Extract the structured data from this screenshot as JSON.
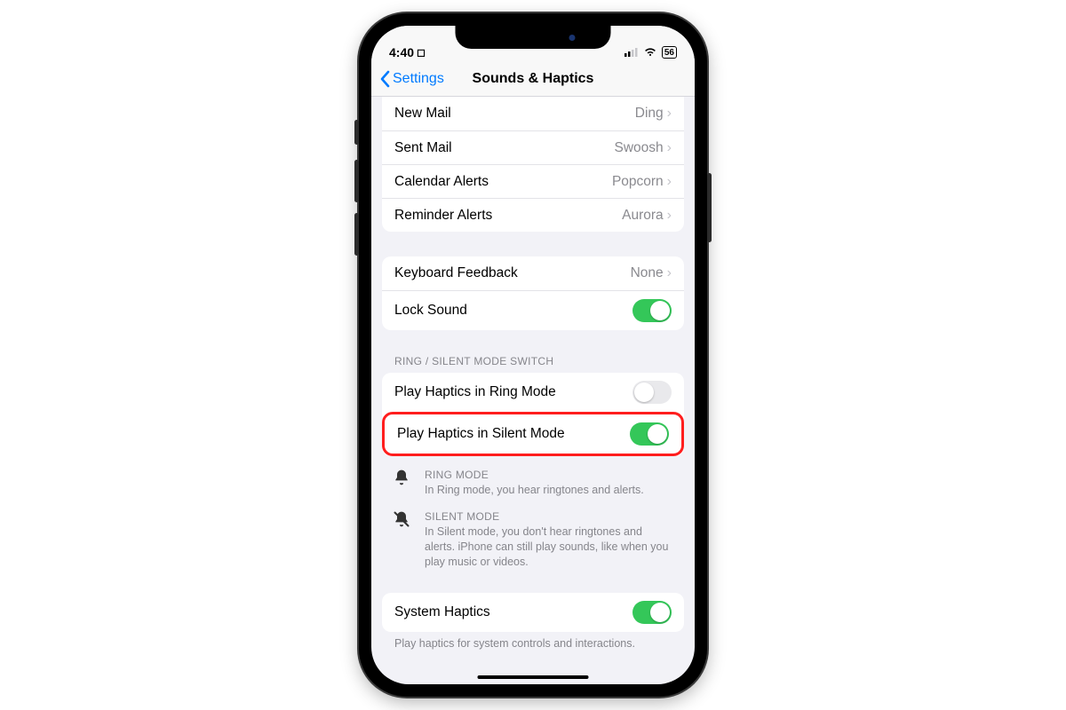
{
  "status": {
    "time": "4:40",
    "battery": "56"
  },
  "nav": {
    "back": "Settings",
    "title": "Sounds & Haptics"
  },
  "sounds": {
    "new_mail": {
      "label": "New Mail",
      "value": "Ding"
    },
    "sent_mail": {
      "label": "Sent Mail",
      "value": "Swoosh"
    },
    "calendar": {
      "label": "Calendar Alerts",
      "value": "Popcorn"
    },
    "reminder": {
      "label": "Reminder Alerts",
      "value": "Aurora"
    }
  },
  "feedback": {
    "keyboard": {
      "label": "Keyboard Feedback",
      "value": "None"
    },
    "lock": {
      "label": "Lock Sound"
    }
  },
  "section_ring_header": "RING / SILENT MODE SWITCH",
  "haptics": {
    "ring": {
      "label": "Play Haptics in Ring Mode"
    },
    "silent": {
      "label": "Play Haptics in Silent Mode"
    }
  },
  "explain": {
    "ring": {
      "title": "RING MODE",
      "desc": "In Ring mode, you hear ringtones and alerts."
    },
    "silent": {
      "title": "SILENT MODE",
      "desc": "In Silent mode, you don't hear ringtones and alerts. iPhone can still play sounds, like when you play music or videos."
    }
  },
  "system": {
    "label": "System Haptics",
    "note": "Play haptics for system controls and interactions."
  }
}
